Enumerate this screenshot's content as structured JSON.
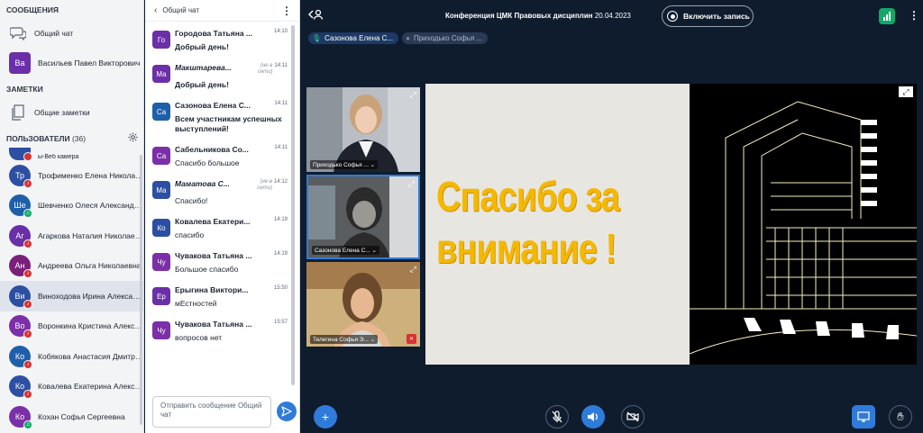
{
  "sidebar": {
    "messages_title": "СООБЩЕНИЯ",
    "general_chat": "Общий чат",
    "private_chat": {
      "initials": "Ва",
      "name": "Васильев Павел Викторович",
      "color": "#6b2fa8"
    },
    "notes_title": "ЗАМЕТКИ",
    "shared_notes": "Общие заметки",
    "users_title": "ПОЛЬЗОВАТЕЛИ",
    "users_count": "(36)",
    "partial_user": "ы-Веб камера",
    "users": [
      {
        "initials": "Тр",
        "name": "Трофименко Елена Николаевна",
        "color": "#2d4fa3",
        "status": "red"
      },
      {
        "initials": "Ше",
        "name": "Шевченко Олеся Александровна",
        "color": "#1f5faa",
        "status": "green"
      },
      {
        "initials": "Аг",
        "name": "Агаркова Наталия Николаевна",
        "color": "#6b2fa8",
        "status": "red"
      },
      {
        "initials": "Ан",
        "name": "Андреева Ольга Николаевна",
        "color": "#7a1f7a",
        "status": "red"
      },
      {
        "initials": "Ви",
        "name": "Виноходова Ирина Александровна",
        "color": "#2d4fa3",
        "status": "red",
        "selected": true
      },
      {
        "initials": "Во",
        "name": "Воронкина Кристина Александровна",
        "color": "#7b2fa8",
        "status": "red"
      },
      {
        "initials": "Ко",
        "name": "Кобякова Анастасия Дмитриевна",
        "color": "#1f5faa",
        "status": "red"
      },
      {
        "initials": "Ко",
        "name": "Ковалева Екатерина Александровна",
        "color": "#2d4fa3",
        "status": "red"
      },
      {
        "initials": "Ко",
        "name": "Кохан Софья Сергеевна",
        "color": "#7b2fa8",
        "status": "green"
      }
    ]
  },
  "chat": {
    "title": "Общий чат",
    "placeholder": "Отправить сообщение Общий чат",
    "messages": [
      {
        "initials": "Го",
        "name": "Городова Татьяна ...",
        "time": "14:10",
        "offline": "",
        "text": "Добрый день!",
        "color": "#6b2fa8"
      },
      {
        "initials": "Ма",
        "name": "Макштарева...",
        "time": "14:11",
        "offline": "(не в сети)",
        "text": "Добрый день!",
        "color": "#6b2fa8"
      },
      {
        "initials": "Са",
        "name": "Сазонова Елена С...",
        "time": "14:11",
        "offline": "",
        "text": "Всем участникам успешных выступлений!",
        "color": "#1f5faa"
      },
      {
        "initials": "Са",
        "name": "Сабельникова Со...",
        "time": "14:11",
        "offline": "",
        "text": "Спасибо большое",
        "color": "#7b2fa8"
      },
      {
        "initials": "Ма",
        "name": "Маматова С...",
        "time": "14:12",
        "offline": "(не в сети)",
        "text": "Спасибо!",
        "color": "#2d4fa3"
      },
      {
        "initials": "Ко",
        "name": "Ковалева Екатери...",
        "time": "14:19",
        "offline": "",
        "text": "спасибо",
        "color": "#2d4fa3"
      },
      {
        "initials": "Чу",
        "name": "Чувакова Татьяна ...",
        "time": "14:19",
        "offline": "",
        "text": "Большое спасибо",
        "color": "#7b2fa8"
      },
      {
        "initials": "Ер",
        "name": "Ерыгина Виктори...",
        "time": "15:50",
        "offline": "",
        "text": "мЕстностей",
        "color": "#6b2fa8"
      },
      {
        "initials": "Чу",
        "name": "Чувакова Татьяна ...",
        "time": "15:57",
        "offline": "",
        "text": "вопросов нет",
        "color": "#7b2fa8"
      }
    ]
  },
  "conference": {
    "title": "Конференция ЦМК Правовых дисциплин",
    "date": "20.04.2023",
    "record_label": "Включить запись",
    "talking": [
      "Сазонова Елена С...",
      "Приходько Софья ..."
    ],
    "videos": [
      {
        "label": "Приходько Софья ...",
        "muted": false
      },
      {
        "label": "Сазонова Елена С...",
        "muted": false
      },
      {
        "label": "Телегина Софья Э...",
        "muted": true
      }
    ],
    "slide_text_line1": "Спасибо за",
    "slide_text_line2": "внимание !"
  },
  "colors": {
    "accent": "#2f7bd9",
    "dark_bg": "#0f1c2e",
    "slide_yellow": "#f5b800",
    "offline_red": "#d93131",
    "online_green": "#13a86a"
  }
}
